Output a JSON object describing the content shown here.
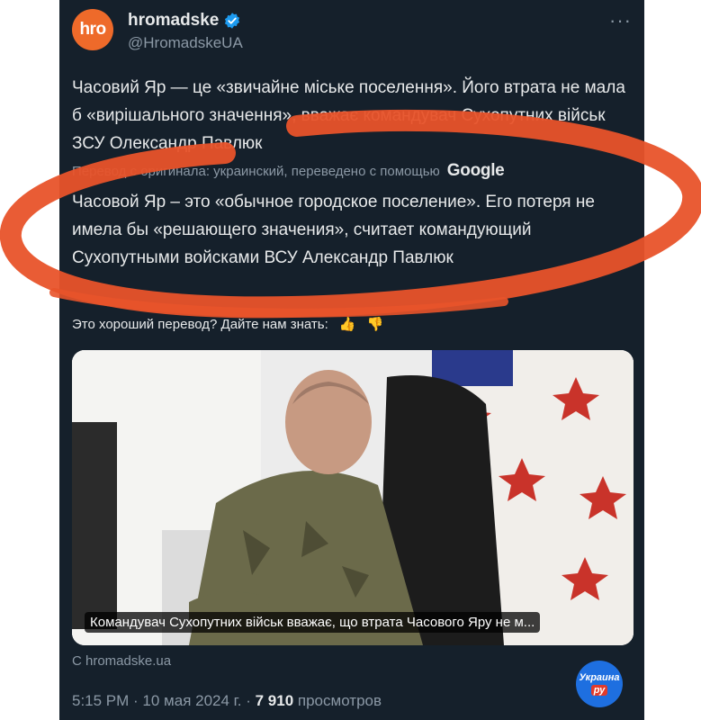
{
  "author": {
    "avatar_text": "hro",
    "name": "hromadske",
    "handle": "@HromadskeUA",
    "more": "···"
  },
  "tweet": {
    "original_text": "Часовий Яр — це «звичайне міське поселення». Його втрата не мала б «вирішального значення», вважає командувач Сухопутних військ ЗСУ Олександр Павлюк",
    "translated_from": "Перевод с оригинала: украинский, переведено с помощью",
    "google": "Google",
    "translated_text": "Часовой Яр – это «обычное городское поселение». Его потеря не имела бы «решающего значения», считает командующий Сухопутными войсками ВСУ Александр Павлюк",
    "feedback": "Это хороший перевод? Дайте нам знать:",
    "thumb_up": "👍",
    "thumb_down": "👎"
  },
  "media": {
    "caption": "Командувач Сухопутних військ вважає, що втрата Часового Яру не м...",
    "source": "С hromadske.ua"
  },
  "meta": {
    "time": "5:15 PM · 10 мая 2024 г. · ",
    "views_count": "7 910",
    "views_label": " просмотров"
  },
  "watermark": {
    "line1": "Украина",
    "line2": "ру"
  },
  "colors": {
    "background": "#15202b",
    "text": "#e7e9ea",
    "muted": "#8b98a5",
    "verified": "#1d9bf0",
    "avatar": "#ee6a2a",
    "annotation": "#e8532a"
  }
}
